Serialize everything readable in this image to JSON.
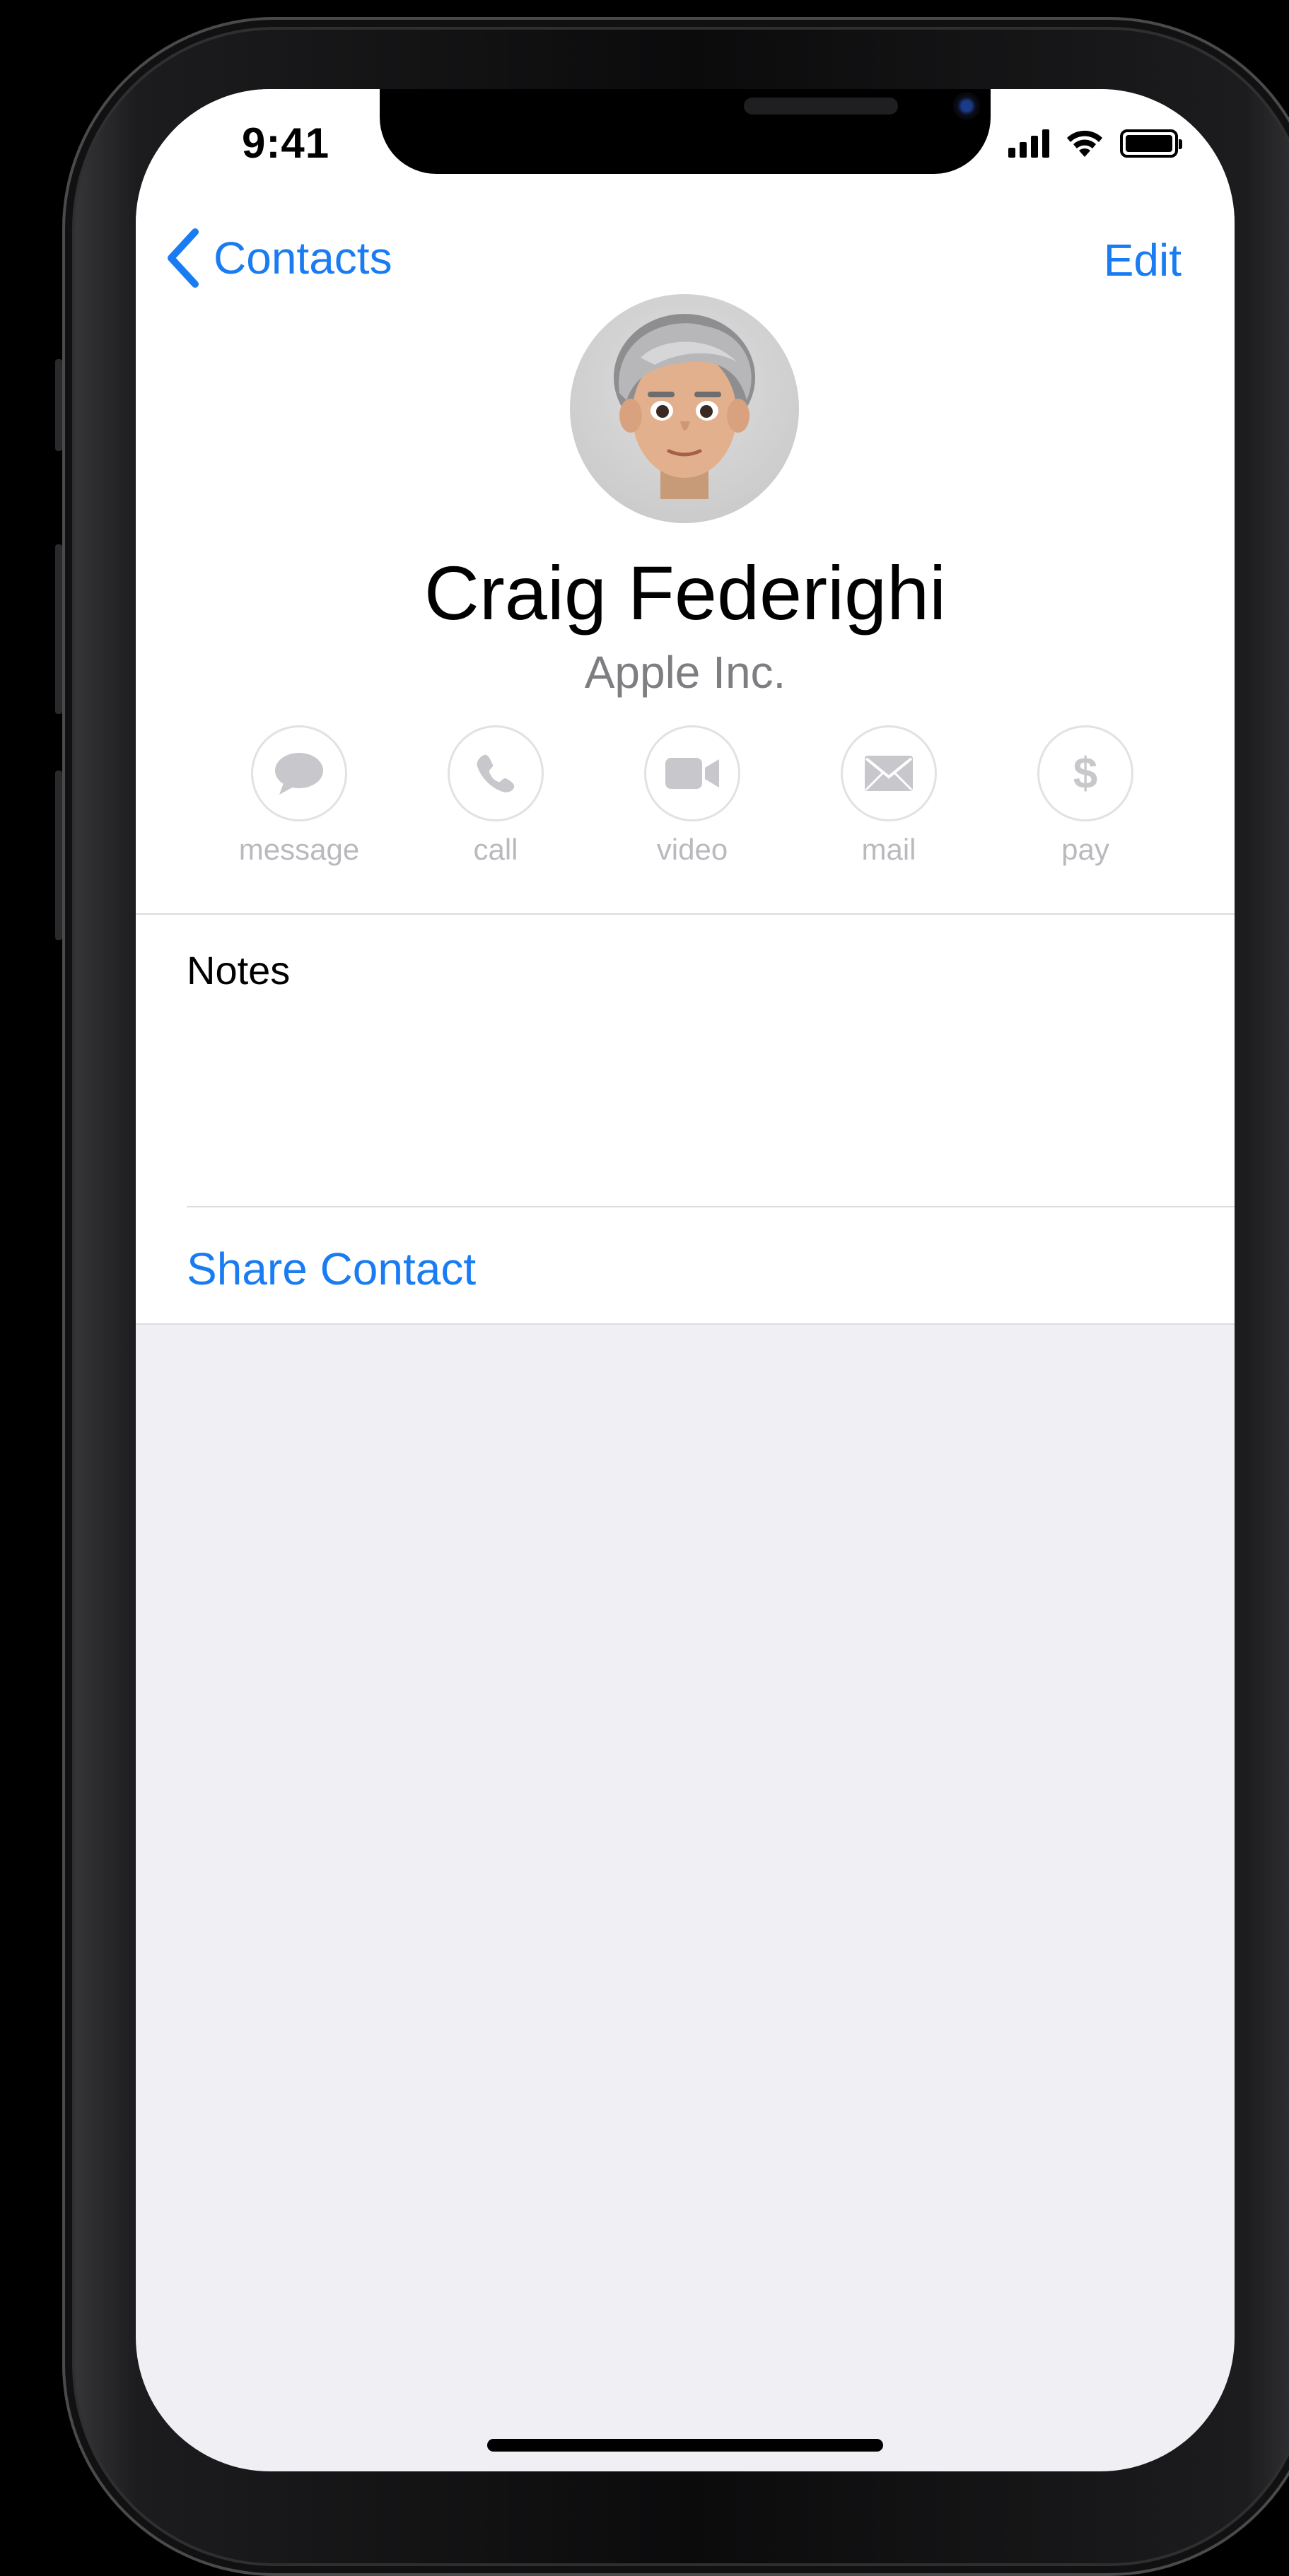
{
  "status_bar": {
    "time": "9:41"
  },
  "nav": {
    "back_label": "Contacts",
    "edit_label": "Edit"
  },
  "contact": {
    "name": "Craig Federighi",
    "company": "Apple Inc."
  },
  "actions": [
    {
      "label": "message",
      "icon": "message-bubble-icon"
    },
    {
      "label": "call",
      "icon": "phone-icon"
    },
    {
      "label": "video",
      "icon": "video-camera-icon"
    },
    {
      "label": "mail",
      "icon": "envelope-icon"
    },
    {
      "label": "pay",
      "icon": "dollar-icon"
    }
  ],
  "sections": {
    "notes_label": "Notes",
    "share_label": "Share Contact"
  },
  "colors": {
    "accent": "#1a7cf2",
    "disabled_action": "#c7c7cc",
    "background_grouped": "#efeff4"
  }
}
